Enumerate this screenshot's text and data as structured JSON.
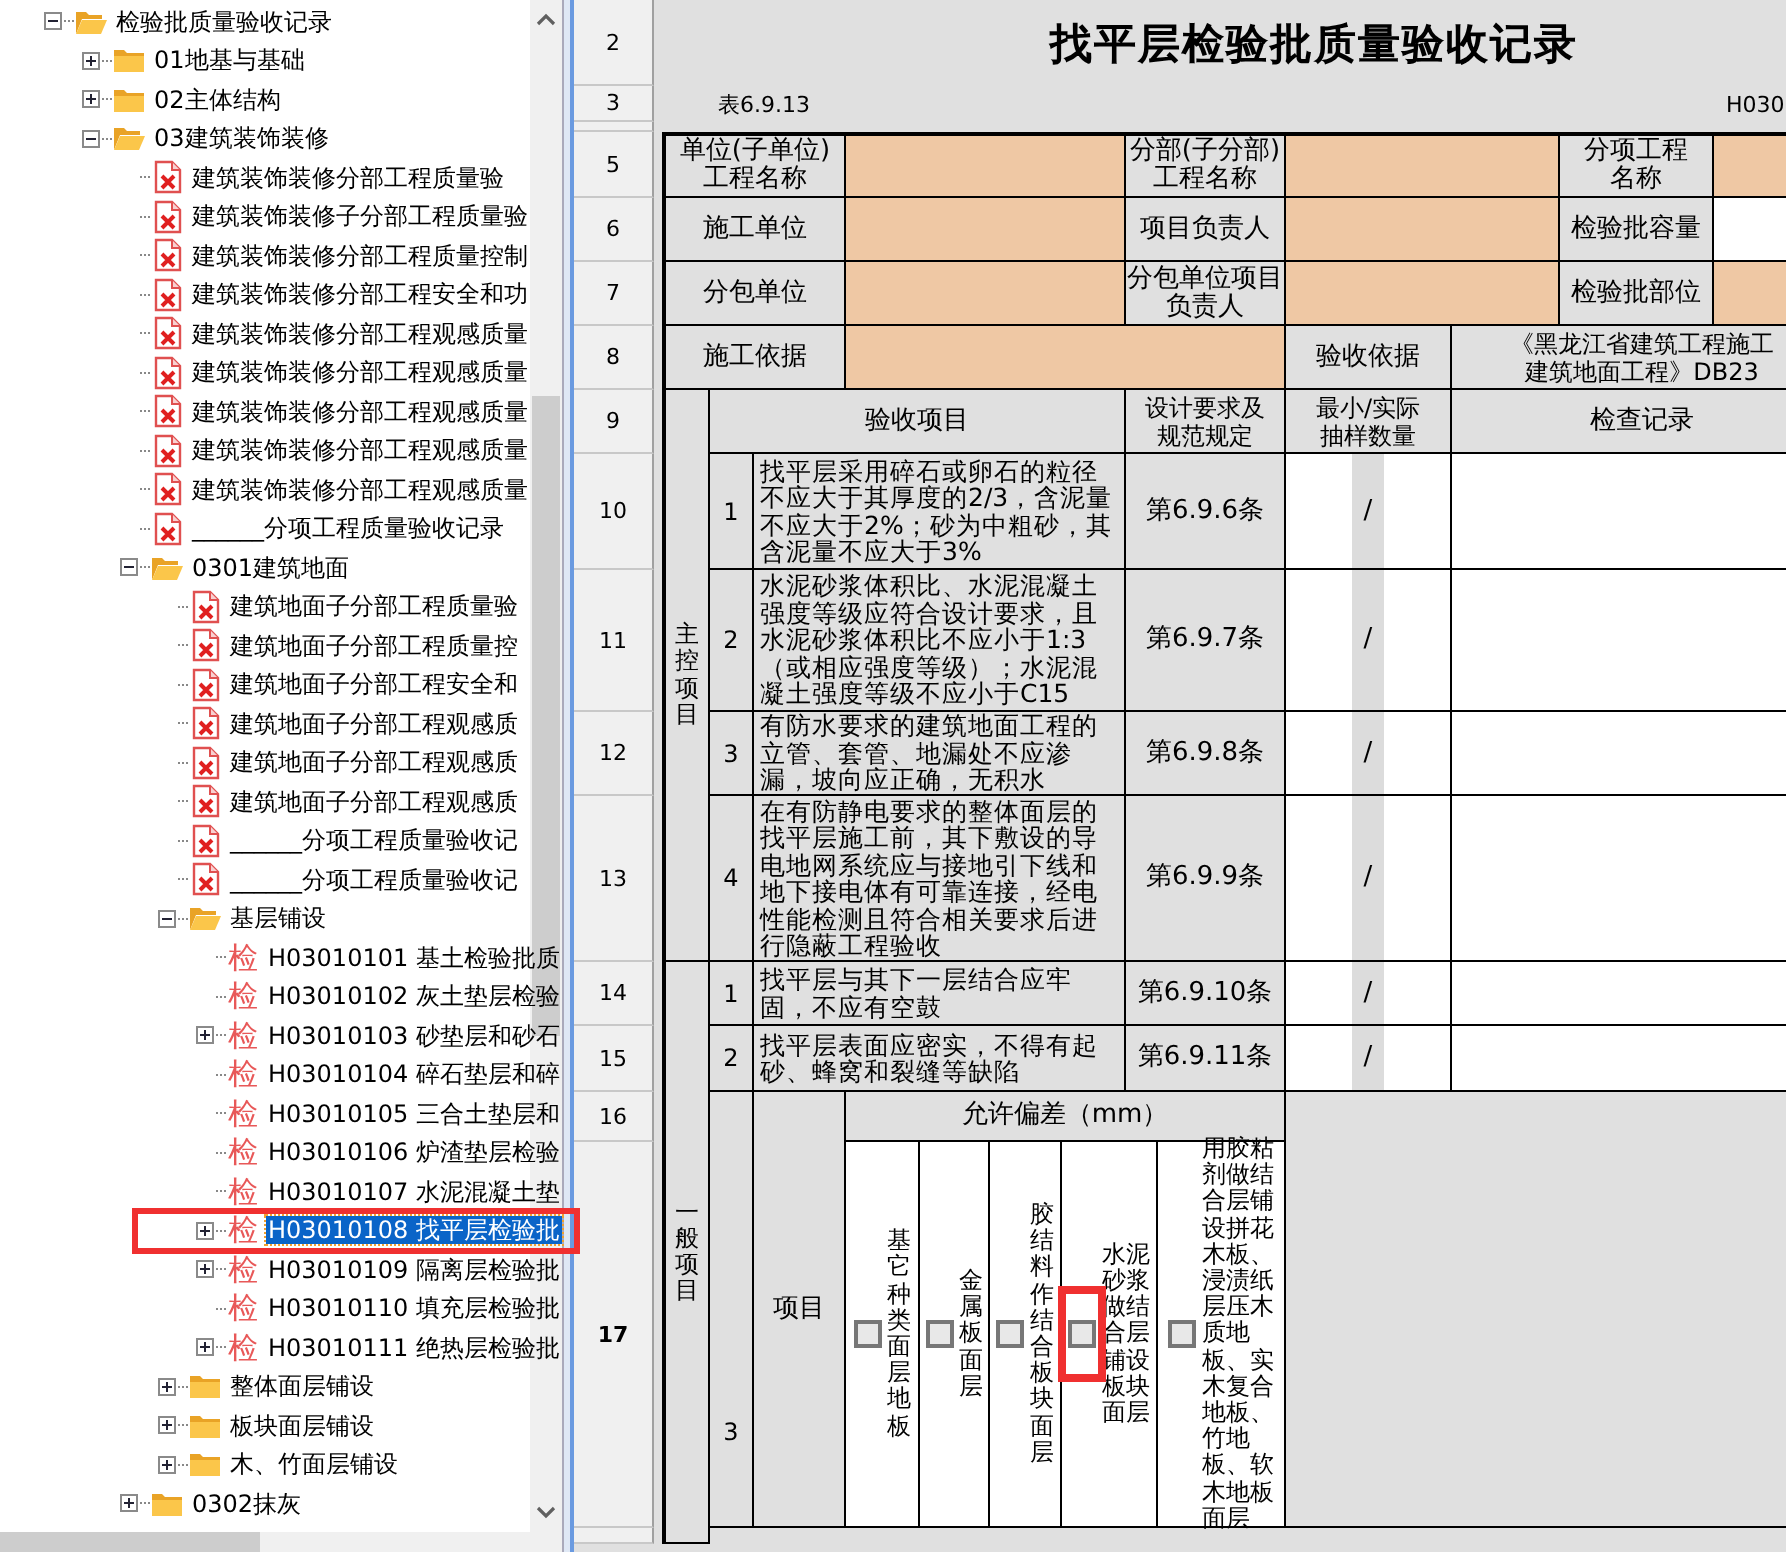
{
  "tree": {
    "items": [
      {
        "label": "检验批质量验收记录",
        "kind": "folder",
        "expanded": true,
        "selected": false,
        "children": [
          {
            "label": "01地基与基础",
            "kind": "folder",
            "expanded": false,
            "selected": false
          },
          {
            "label": "02主体结构",
            "kind": "folder",
            "expanded": false,
            "selected": false
          },
          {
            "label": "03建筑装饰装修",
            "kind": "folder",
            "expanded": true,
            "selected": false,
            "children": [
              {
                "label": "建筑装饰装修分部工程质量验",
                "kind": "doc",
                "selected": false
              },
              {
                "label": "建筑装饰装修子分部工程质量验",
                "kind": "doc",
                "selected": false
              },
              {
                "label": "建筑装饰装修分部工程质量控制",
                "kind": "doc",
                "selected": false
              },
              {
                "label": "建筑装饰装修分部工程安全和功",
                "kind": "doc",
                "selected": false
              },
              {
                "label": "建筑装饰装修分部工程观感质量",
                "kind": "doc",
                "selected": false
              },
              {
                "label": "建筑装饰装修分部工程观感质量",
                "kind": "doc",
                "selected": false
              },
              {
                "label": "建筑装饰装修分部工程观感质量",
                "kind": "doc",
                "selected": false
              },
              {
                "label": "建筑装饰装修分部工程观感质量",
                "kind": "doc",
                "selected": false
              },
              {
                "label": "建筑装饰装修分部工程观感质量",
                "kind": "doc",
                "selected": false
              },
              {
                "label": "______分项工程质量验收记录",
                "kind": "doc",
                "selected": false
              },
              {
                "label": "0301建筑地面",
                "kind": "folder",
                "expanded": true,
                "selected": false,
                "children": [
                  {
                    "label": "建筑地面子分部工程质量验",
                    "kind": "doc",
                    "selected": false
                  },
                  {
                    "label": "建筑地面子分部工程质量控",
                    "kind": "doc",
                    "selected": false
                  },
                  {
                    "label": "建筑地面子分部工程安全和",
                    "kind": "doc",
                    "selected": false
                  },
                  {
                    "label": "建筑地面子分部工程观感质",
                    "kind": "doc",
                    "selected": false
                  },
                  {
                    "label": "建筑地面子分部工程观感质",
                    "kind": "doc",
                    "selected": false
                  },
                  {
                    "label": "建筑地面子分部工程观感质",
                    "kind": "doc",
                    "selected": false
                  },
                  {
                    "label": "______分项工程质量验收记",
                    "kind": "doc",
                    "selected": false
                  },
                  {
                    "label": "______分项工程质量验收记",
                    "kind": "doc",
                    "selected": false
                  },
                  {
                    "label": "基层铺设",
                    "kind": "folder",
                    "expanded": true,
                    "selected": false,
                    "children": [
                      {
                        "label": "H03010101 基土检验批质",
                        "kind": "check",
                        "badge": "检",
                        "selected": false
                      },
                      {
                        "label": "H03010102 灰土垫层检验",
                        "kind": "check",
                        "badge": "检",
                        "selected": false
                      },
                      {
                        "label": "H03010103 砂垫层和砂石",
                        "kind": "check",
                        "badge": "检",
                        "expanded": false,
                        "selected": false
                      },
                      {
                        "label": "H03010104 碎石垫层和碎",
                        "kind": "check",
                        "badge": "检",
                        "selected": false
                      },
                      {
                        "label": "H03010105 三合土垫层和",
                        "kind": "check",
                        "badge": "检",
                        "selected": false
                      },
                      {
                        "label": "H03010106 炉渣垫层检验",
                        "kind": "check",
                        "badge": "检",
                        "selected": false
                      },
                      {
                        "label": "H03010107 水泥混凝土垫",
                        "kind": "check",
                        "badge": "检",
                        "selected": false
                      },
                      {
                        "label": "H03010108 找平层检验批",
                        "kind": "check",
                        "badge": "检",
                        "expanded": false,
                        "selected": true,
                        "highlighted": true
                      },
                      {
                        "label": "H03010109 隔离层检验批",
                        "kind": "check",
                        "badge": "检",
                        "expanded": false,
                        "selected": false
                      },
                      {
                        "label": "H03010110 填充层检验批",
                        "kind": "check",
                        "badge": "检",
                        "selected": false
                      },
                      {
                        "label": "H03010111 绝热层检验批",
                        "kind": "check",
                        "badge": "检",
                        "expanded": false,
                        "selected": false
                      }
                    ]
                  },
                  {
                    "label": "整体面层铺设",
                    "kind": "folder",
                    "expanded": false,
                    "selected": false
                  },
                  {
                    "label": "板块面层铺设",
                    "kind": "folder",
                    "expanded": false,
                    "selected": false
                  },
                  {
                    "label": "木、竹面层铺设",
                    "kind": "folder",
                    "expanded": false,
                    "selected": false
                  }
                ]
              },
              {
                "label": "0302抹灰",
                "kind": "folder",
                "expanded": false,
                "selected": false
              }
            ]
          }
        ]
      }
    ]
  },
  "sheet": {
    "row_headers": [
      {
        "label": "2",
        "selected": false
      },
      {
        "label": "3",
        "selected": false
      },
      {
        "label": "5",
        "selected": false
      },
      {
        "label": "6",
        "selected": false
      },
      {
        "label": "7",
        "selected": false
      },
      {
        "label": "8",
        "selected": false
      },
      {
        "label": "9",
        "selected": false
      },
      {
        "label": "10",
        "selected": false
      },
      {
        "label": "11",
        "selected": false
      },
      {
        "label": "12",
        "selected": false
      },
      {
        "label": "13",
        "selected": false
      },
      {
        "label": "14",
        "selected": false
      },
      {
        "label": "15",
        "selected": false
      },
      {
        "label": "16",
        "selected": false
      },
      {
        "label": "17",
        "selected": true
      }
    ],
    "title": "找平层检验批质量验收记录",
    "table_no": "表6.9.13",
    "code": "H030",
    "info": [
      [
        {
          "kind": "label",
          "lines": [
            "单位(子单位)",
            "工程名称"
          ]
        },
        {
          "kind": "value",
          "color": "#efc8a4"
        },
        {
          "kind": "label",
          "lines": [
            "分部(子分部)",
            "工程名称"
          ]
        },
        {
          "kind": "value",
          "color": "#efc8a4"
        },
        {
          "kind": "label",
          "lines": [
            "分项工程",
            "名称"
          ]
        },
        {
          "kind": "value",
          "color": "#efc8a4"
        }
      ],
      [
        {
          "kind": "label",
          "lines": [
            "施工单位"
          ]
        },
        {
          "kind": "value",
          "color": "#efc8a4"
        },
        {
          "kind": "label",
          "lines": [
            "项目负责人"
          ]
        },
        {
          "kind": "value",
          "color": "#efc8a4"
        },
        {
          "kind": "label",
          "lines": [
            "检验批容量"
          ]
        },
        {
          "kind": "value",
          "color": "#ffffff"
        }
      ],
      [
        {
          "kind": "label",
          "lines": [
            "分包单位"
          ]
        },
        {
          "kind": "value",
          "color": "#efc8a4"
        },
        {
          "kind": "label",
          "lines": [
            "分包单位项目",
            "负责人"
          ]
        },
        {
          "kind": "value",
          "color": "#efc8a4"
        },
        {
          "kind": "label",
          "lines": [
            "检验批部位"
          ]
        },
        {
          "kind": "value",
          "color": "#efc8a4"
        }
      ],
      [
        {
          "kind": "label",
          "lines": [
            "施工依据"
          ]
        },
        {
          "kind": "value",
          "color": "#efc8a4"
        },
        {
          "kind": "label",
          "lines": [
            "验收依据"
          ]
        },
        {
          "kind": "value",
          "color": "#e0e0e0",
          "lines": [
            "《黑龙江省建筑工程施工",
            "建筑地面工程》DB23"
          ]
        }
      ]
    ],
    "header": {
      "item": [
        "验收项目"
      ],
      "clause": [
        "设计要求及",
        "规范规定"
      ],
      "sample": [
        "最小/实际",
        "抽样数量"
      ],
      "record": [
        "检查记录"
      ]
    },
    "groups": [
      {
        "label": "主控项目",
        "items": [
          {
            "no": "1",
            "text": "找平层采用碎石或卵石的粒径不应大于其厚度的2/3，含泥量不应大于2%；砂为中粗砂，其含泥量不应大于3%",
            "clause": "第6.9.6条",
            "sample": "/"
          },
          {
            "no": "2",
            "text": "水泥砂浆体积比、水泥混凝土强度等级应符合设计要求，且水泥砂浆体积比不应小于1:3（或相应强度等级）；水泥混凝土强度等级不应小于C15",
            "clause": "第6.9.7条",
            "sample": "/"
          },
          {
            "no": "3",
            "text": "有防水要求的建筑地面工程的立管、套管、地漏处不应渗漏，坡向应正确，无积水",
            "clause": "第6.9.8条",
            "sample": "/"
          },
          {
            "no": "4",
            "text": "在有防静电要求的整体面层的找平层施工前，其下敷设的导电地网系统应与接地引下线和地下接电体有可靠连接，经电性能检测且符合相关要求后进行隐蔽工程验收",
            "clause": "第6.9.9条",
            "sample": "/"
          }
        ]
      },
      {
        "label": "一般项目",
        "items": [
          {
            "no": "1",
            "text": "找平层与其下一层结合应牢固，不应有空鼓",
            "clause": "第6.9.10条",
            "sample": "/"
          },
          {
            "no": "2",
            "text": "找平层表面应密实，不得有起砂、蜂窝和裂缝等缺陷",
            "clause": "第6.9.11条",
            "sample": "/"
          }
        ],
        "deviation": {
          "no": "3",
          "item": "项目",
          "header": "允许偏差（mm）",
          "options": [
            {
              "label": "基它种类面层地板",
              "checked": false,
              "highlighted": false
            },
            {
              "label": "金属板面层",
              "checked": false,
              "highlighted": false
            },
            {
              "label": "胶结料作结合板块面层",
              "checked": false,
              "highlighted": false
            },
            {
              "label": "水泥砂浆做结合层铺设板块面层",
              "checked": false,
              "highlighted": true
            },
            {
              "label": "用胶粘剂做结合层铺设拼花木板、浸渍纸层压木质地板、实木复合地板、竹地板、软木地板面层",
              "checked": false,
              "highlighted": false
            }
          ]
        }
      }
    ]
  }
}
